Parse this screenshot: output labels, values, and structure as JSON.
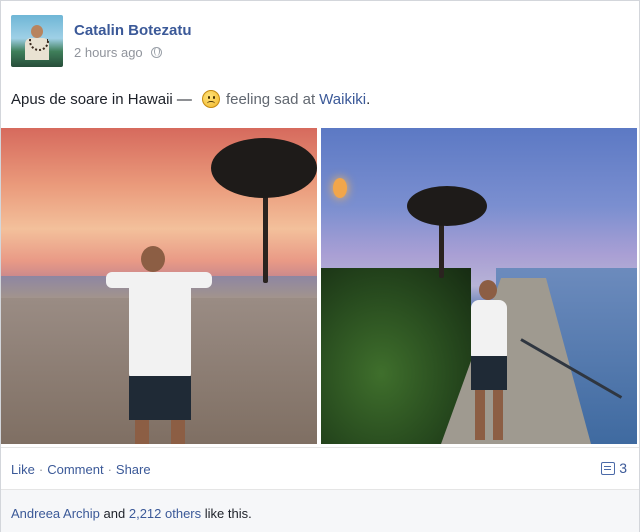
{
  "post": {
    "author": "Catalin Botezatu",
    "timestamp": "2 hours ago",
    "privacy_icon": "globe-icon",
    "status_text": "Apus de soare in Hawaii —",
    "feeling_text": "feeling sad at",
    "location": "Waikiki",
    "location_suffix": "."
  },
  "actions": {
    "like": "Like",
    "comment": "Comment",
    "share": "Share",
    "separator": "·",
    "comment_count": "3"
  },
  "likes": {
    "first_name": "Andreea Archip",
    "and": "and",
    "others": "2,212 others",
    "suffix": "like this."
  },
  "colors": {
    "link": "#3b5998",
    "text": "#1d2129",
    "meta": "#90949c"
  }
}
